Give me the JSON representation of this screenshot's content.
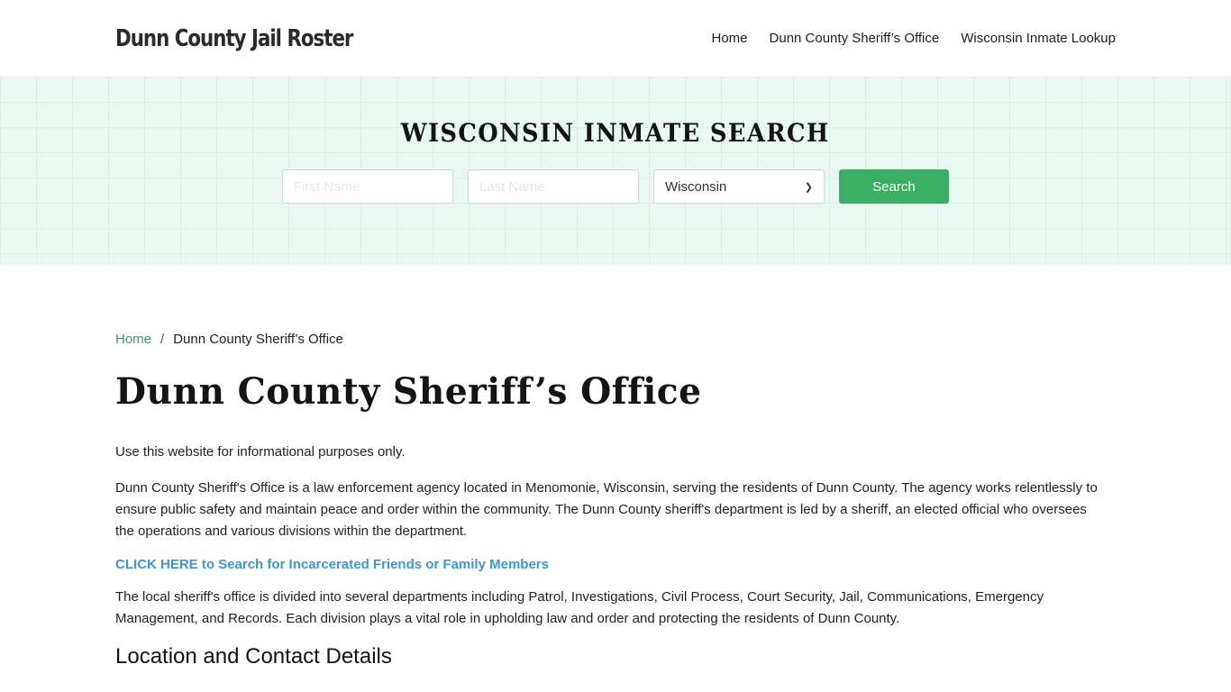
{
  "header": {
    "logo": "Dunn County Jail Roster",
    "nav": [
      {
        "label": "Home"
      },
      {
        "label": "Dunn County Sheriff’s Office"
      },
      {
        "label": "Wisconsin Inmate Lookup"
      }
    ]
  },
  "hero": {
    "title": "WISCONSIN INMATE SEARCH",
    "first_name_placeholder": "First Name",
    "last_name_placeholder": "Last Name",
    "state_selected": "Wisconsin",
    "search_label": "Search",
    "background_color": "#eaf8f2",
    "button_color": "#3aae62"
  },
  "breadcrumb": {
    "home": "Home",
    "separator": "/",
    "current": "Dunn County Sheriff’s Office"
  },
  "main": {
    "title": "Dunn County Sheriff’s Office",
    "disclaimer": "Use this website for informational purposes only.",
    "intro": "Dunn County Sheriff's Office is a law enforcement agency located in Menomonie, Wisconsin, serving the residents of Dunn County. The agency works relentlessly to ensure public safety and maintain peace and order within the community. The Dunn County sheriff's department is led by a sheriff, an elected official who oversees the operations and various divisions within the department.",
    "cta_link": "CLICK HERE to Search for Incarcerated Friends or Family Members",
    "departments": "The local sheriff's office is divided into several departments including Patrol, Investigations, Civil Process, Court Security, Jail, Communications, Emergency Management, and Records. Each division plays a vital role in upholding law and order and protecting the residents of Dunn County.",
    "section_heading": "Location and Contact Details"
  },
  "colors": {
    "link_green": "#3a9a68",
    "link_blue": "#3a97cf"
  }
}
